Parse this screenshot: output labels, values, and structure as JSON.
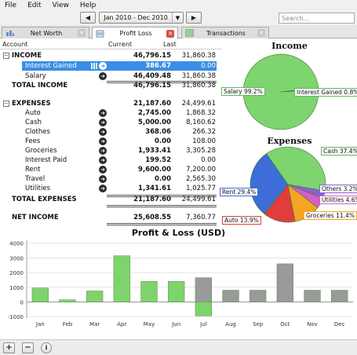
{
  "menu": {
    "items": [
      "File",
      "Edit",
      "View",
      "Help"
    ]
  },
  "toolbar": {
    "prev_icon": "triangle-left-icon",
    "next_icon": "triangle-right-icon",
    "period_value": "Jan 2010 - Dec 2010",
    "search_placeholder": "Search..."
  },
  "tabs": [
    {
      "label": "Net Worth",
      "icon": "net-worth-icon",
      "active": false
    },
    {
      "label": "Profit Loss",
      "icon": "profit-loss-icon",
      "active": true
    },
    {
      "label": "Transactions",
      "icon": "transactions-icon",
      "active": false
    }
  ],
  "report": {
    "headers": {
      "account": "Account",
      "current": "Current",
      "last": "Last"
    },
    "income": {
      "label": "INCOME",
      "current": "46,796.15",
      "last": "31,860.38",
      "items": [
        {
          "name": "Interest Gained",
          "current": "386.67",
          "last": "0.00"
        },
        {
          "name": "Salary",
          "current": "46,409.48",
          "last": "31,860.38"
        }
      ],
      "total_label": "TOTAL INCOME",
      "total_current": "46,796.15",
      "total_last": "31,860.38"
    },
    "expenses": {
      "label": "EXPENSES",
      "current": "21,187.60",
      "last": "24,499.61",
      "items": [
        {
          "name": "Auto",
          "current": "2,745.00",
          "last": "1,868.32"
        },
        {
          "name": "Cash",
          "current": "5,000.00",
          "last": "8,160.62"
        },
        {
          "name": "Clothes",
          "current": "368.06",
          "last": "266.32"
        },
        {
          "name": "Fees",
          "current": "0.00",
          "last": "108.00"
        },
        {
          "name": "Groceries",
          "current": "1,933.41",
          "last": "3,305.28"
        },
        {
          "name": "Interest Paid",
          "current": "199.52",
          "last": "0.00"
        },
        {
          "name": "Rent",
          "current": "9,600.00",
          "last": "7,200.00"
        },
        {
          "name": "Travel",
          "current": "0.00",
          "last": "2,565.30"
        },
        {
          "name": "Utilities",
          "current": "1,341.61",
          "last": "1,025.77"
        }
      ],
      "total_label": "TOTAL EXPENSES",
      "total_current": "21,187.60",
      "total_last": "24,499.61"
    },
    "net": {
      "label": "NET INCOME",
      "current": "25,608.55",
      "last": "7,360.77"
    }
  },
  "pies": {
    "income": {
      "title": "Income",
      "slices": [
        {
          "label": "Salary 99.2%",
          "value": 99.2,
          "color": "#7ed46f"
        },
        {
          "label": "Interest Gained 0.8%",
          "value": 0.8,
          "color": "#3e86d8"
        }
      ]
    },
    "expenses": {
      "title": "Expenses",
      "slices": [
        {
          "label": "Cash 37.4%",
          "value": 37.4,
          "color": "#7ed46f"
        },
        {
          "label": "Others 3.2%",
          "value": 3.2,
          "color": "#8c5fd6"
        },
        {
          "label": "Utilities 4.6%",
          "value": 4.6,
          "color": "#d65fc8"
        },
        {
          "label": "Groceries 11.4%",
          "value": 11.4,
          "color": "#f4a526"
        },
        {
          "label": "Auto 13.9%",
          "value": 13.9,
          "color": "#e23c3c"
        },
        {
          "label": "Rent 29.4%",
          "value": 29.4,
          "color": "#3d6ed8"
        }
      ]
    }
  },
  "chart_data": {
    "type": "bar",
    "title": "Profit & Loss (USD)",
    "categories": [
      "Jan",
      "Feb",
      "Mar",
      "Apr",
      "May",
      "Jun",
      "Jul",
      "Aug",
      "Sep",
      "Oct",
      "Nov",
      "Dec"
    ],
    "values": [
      950,
      150,
      750,
      3150,
      1400,
      1400,
      1650,
      800,
      800,
      2600,
      800,
      800
    ],
    "negative_values": [
      0,
      0,
      0,
      0,
      0,
      0,
      -950,
      0,
      0,
      0,
      0,
      0
    ],
    "bar_colors": [
      "#7fd36d",
      "#7fd36d",
      "#7fd36d",
      "#7fd36d",
      "#7fd36d",
      "#7fd36d",
      "#9a9a9a",
      "#9a9a9a",
      "#9a9a9a",
      "#9a9a9a",
      "#9a9a9a",
      "#9a9a9a"
    ],
    "negative_color": "#7fd36d",
    "yticks": [
      -1000,
      0,
      1000,
      2000,
      3000,
      4000
    ],
    "ylim": [
      -1100,
      4200
    ],
    "grid": true
  },
  "bottombar": {
    "add_label": "+",
    "remove_label": "−",
    "info_label": "i"
  }
}
